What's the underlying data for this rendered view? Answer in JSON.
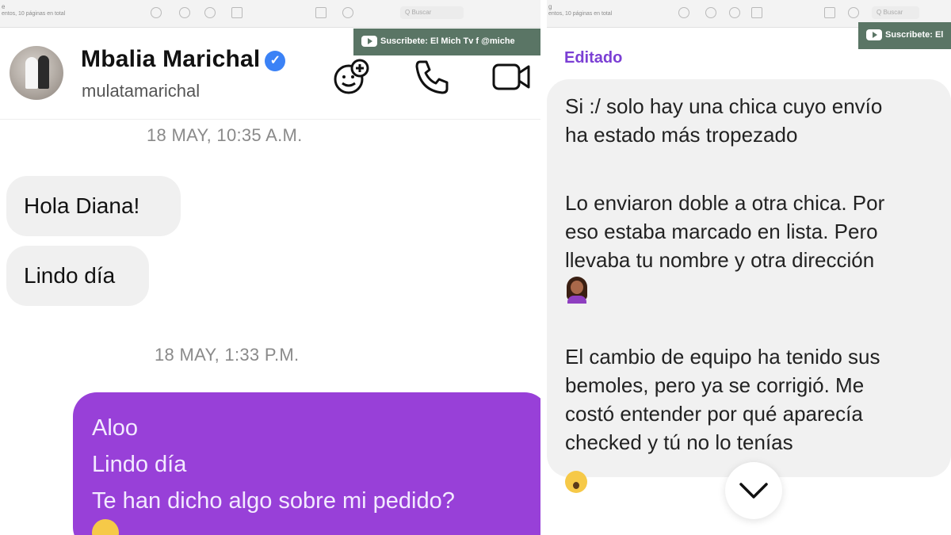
{
  "left": {
    "toolbar": {
      "meta_letter": "e",
      "meta": "entos, 10 páginas en total"
    },
    "banner": {
      "text": "Suscribete: El Mich Tv   f @miche"
    },
    "header": {
      "name": "Mbalia Marichal",
      "username": "mulatamarichal",
      "verified_icon": "verified-badge-icon"
    },
    "timestamps": [
      "18 MAY, 10:35 A.M.",
      "18 MAY, 1:33 P.M."
    ],
    "incoming": [
      "Hola Diana!",
      "Lindo día"
    ],
    "outgoing": {
      "lines": [
        "Aloo",
        "Lindo día",
        "Te han dicho algo sobre mi pedido?"
      ]
    },
    "colors": {
      "accent": "#9840d8",
      "banner": "#5a7565"
    }
  },
  "right": {
    "toolbar": {
      "meta_letter": "g",
      "meta": "entos, 10 páginas en total"
    },
    "banner": {
      "text": "Suscribete: El"
    },
    "edited_label": "Editado",
    "paragraphs": [
      [
        "Si :/ solo hay una chica cuyo envío",
        "ha estado más tropezado"
      ],
      [
        "Lo enviaron doble a otra chica. Por",
        "eso estaba marcado en lista. Pero",
        "llevaba tu nombre y otra dirección"
      ],
      [
        "El cambio de equipo ha tenido sus",
        "bemoles, pero ya se corrigió. Me",
        "costó entender por qué aparecía",
        "checked y tú no lo tenías"
      ]
    ],
    "reaction_icon": "surprised-face-emoji-icon"
  }
}
